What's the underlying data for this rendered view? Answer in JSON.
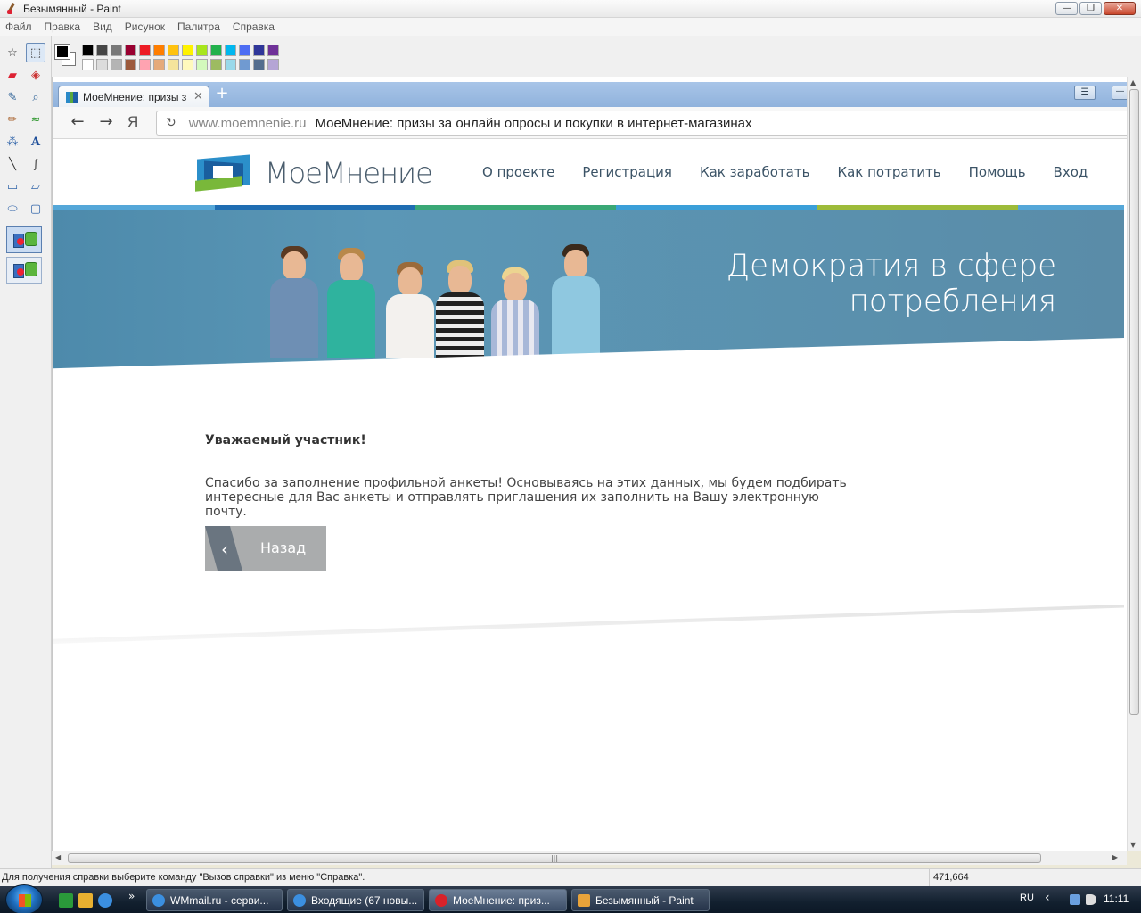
{
  "window": {
    "title": "Безымянный - Paint",
    "controls": {
      "minimize": "—",
      "maximize": "❐",
      "close": "✕"
    }
  },
  "menu": [
    "Файл",
    "Правка",
    "Вид",
    "Рисунок",
    "Палитра",
    "Справка"
  ],
  "toolbox": {
    "tools": [
      {
        "name": "free-form-select",
        "glyph": "☆"
      },
      {
        "name": "select",
        "glyph": "⬚"
      },
      {
        "name": "eraser",
        "glyph": "▰"
      },
      {
        "name": "fill",
        "glyph": "◈"
      },
      {
        "name": "color-picker",
        "glyph": "✎"
      },
      {
        "name": "magnifier",
        "glyph": "⌕"
      },
      {
        "name": "pencil",
        "glyph": "✏"
      },
      {
        "name": "brush",
        "glyph": "≈"
      },
      {
        "name": "airbrush",
        "glyph": "⁂"
      },
      {
        "name": "text",
        "glyph": "A"
      },
      {
        "name": "line",
        "glyph": "╲"
      },
      {
        "name": "curve",
        "glyph": "∫"
      },
      {
        "name": "rectangle",
        "glyph": "▭"
      },
      {
        "name": "polygon",
        "glyph": "▱"
      },
      {
        "name": "ellipse",
        "glyph": "⬭"
      },
      {
        "name": "rounded-rectangle",
        "glyph": "▢"
      }
    ]
  },
  "palette": {
    "top": [
      "#000000",
      "#464646",
      "#787878",
      "#990030",
      "#ed1c24",
      "#ff7e00",
      "#ffc20e",
      "#fff200",
      "#a8e61d",
      "#22b14c",
      "#00b7ef",
      "#4d6df3",
      "#2f3699",
      "#6f3198"
    ],
    "bottom": [
      "#ffffff",
      "#dcdcdc",
      "#b4b4b4",
      "#9c5a3c",
      "#ffa3b1",
      "#e5aa7a",
      "#f5e49c",
      "#fff9bd",
      "#d3f9bc",
      "#9dbb61",
      "#99d9ea",
      "#709ad1",
      "#546d8e",
      "#b5a5d5"
    ]
  },
  "browser": {
    "tab_title": "МоеМнение: призы з",
    "tab_close": "✕",
    "new_tab": "+",
    "menu_btn": "☰",
    "min_btn": "—",
    "back": "←",
    "forward": "→",
    "yandex": "Я",
    "reload": "↻",
    "url": "www.moemnenie.ru",
    "page_title": "МоеМнение: призы за онлайн опросы и покупки в интернет-магазинах"
  },
  "site": {
    "logo_text": "МоеМнение",
    "nav": [
      "О проекте",
      "Регистрация",
      "Как заработать",
      "Как потратить",
      "Помощь",
      "Вход"
    ],
    "stripe_colors": [
      "#55a7d8",
      "#1f6db2",
      "#3aa876",
      "#3b9fd8",
      "#9dbb3a",
      "#55a7d8"
    ],
    "slogan_line1": "Демократия в сфере",
    "slogan_line2": "потребления",
    "greeting": "Уважаемый участник!",
    "message": "Спасибо за заполнение профильной анкеты! Основываясь на этих данных, мы будем подбирать интересные для Вас анкеты и отправлять приглашения их заполнить на Вашу электронную почту.",
    "back_button": "Назад",
    "back_chevron": "‹"
  },
  "scroll": {
    "up": "▲",
    "down": "▼",
    "left": "◀",
    "right": "▶",
    "grip": "|||"
  },
  "status": {
    "text": "Для получения справки выберите команду \"Вызов справки\" из меню \"Справка\".",
    "coords": "471,664"
  },
  "taskbar": {
    "quicklaunch_more": "»",
    "buttons": [
      {
        "label": "WMmail.ru - серви...",
        "icon_color": "#3b8fe0"
      },
      {
        "label": "Входящие (67 новы...",
        "icon_color": "#3b8fe0"
      },
      {
        "label": "МоеМнение: приз...",
        "icon_color": "#d8222a"
      },
      {
        "label": "Безымянный - Paint",
        "icon_color": "#e8a33a"
      }
    ],
    "lang": "RU",
    "tray_arrow": "‹",
    "clock": "11:11"
  }
}
